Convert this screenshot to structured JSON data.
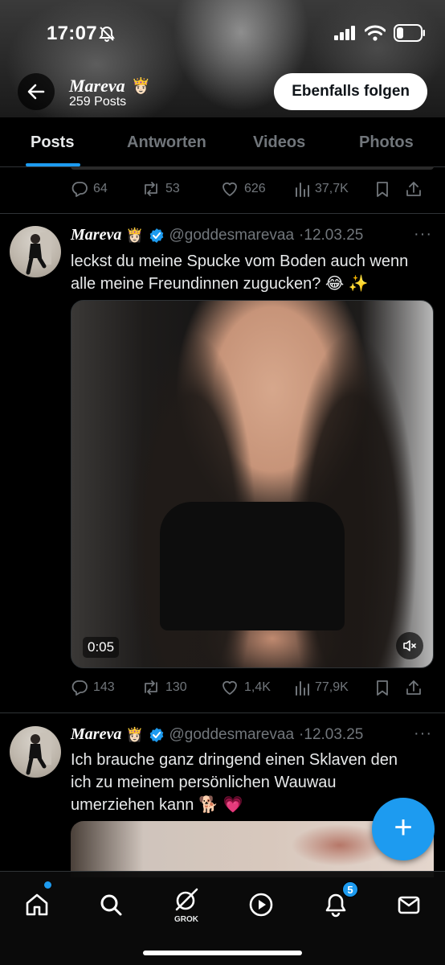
{
  "status_bar": {
    "time": "17:07",
    "icons": [
      "bell-slash-icon",
      "signal-icon",
      "wifi-icon",
      "battery-icon"
    ]
  },
  "profile": {
    "name": "Mareva",
    "crown_emoji": "👸🏻",
    "posts_count": "259 Posts",
    "follow_label": "Ebenfalls folgen"
  },
  "tabs": [
    {
      "label": "Posts",
      "active": true
    },
    {
      "label": "Antworten"
    },
    {
      "label": "Videos"
    },
    {
      "label": "Photos"
    }
  ],
  "prev_post": {
    "replies": "64",
    "reposts": "53",
    "likes": "626",
    "views": "37,7K"
  },
  "post1": {
    "name": "Mareva",
    "emoji": "👸🏻",
    "handle": "@goddesmarevaa",
    "date": "·12.03.25",
    "more": "···",
    "text_line1": "leckst du meine Spucke vom Boden auch wenn",
    "text_line2": "alle meine Freundinnen zugucken? 😂 ✨",
    "video_time": "0:05",
    "replies": "143",
    "reposts": "130",
    "likes": "1,4K",
    "views": "77,9K"
  },
  "post2": {
    "name": "Mareva",
    "emoji": "👸🏻",
    "handle": "@goddesmarevaa",
    "date": "·12.03.25",
    "more": "···",
    "text_line1": "Ich brauche ganz dringend einen Sklaven den",
    "text_line2": "ich zu meinem persönlichen Wauwau",
    "text_line3": "umerziehen kann 🐕 💗"
  },
  "fab_label": "+",
  "bottom_nav": {
    "grok_label": "GROK",
    "notifications_badge": "5"
  },
  "colors": {
    "accent": "#1d9bf0",
    "background": "#000000",
    "muted": "#71767b",
    "text": "#e7e9ea"
  }
}
